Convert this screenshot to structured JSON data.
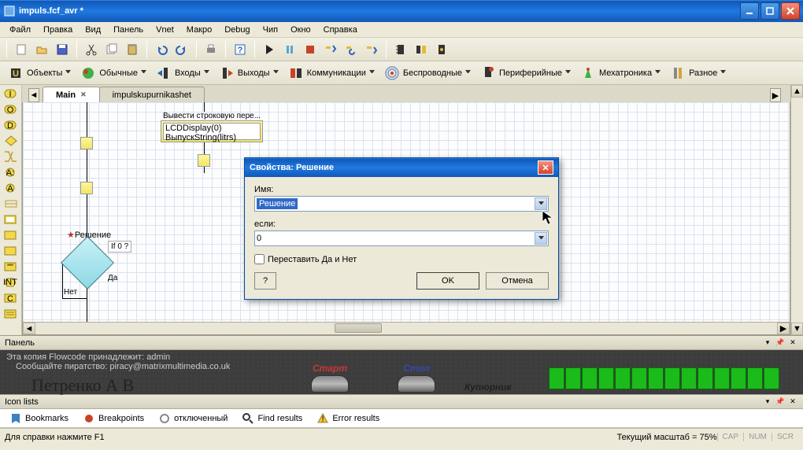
{
  "title": "impuls.fcf_avr *",
  "menu": [
    "Файл",
    "Правка",
    "Вид",
    "Панель",
    "Vnet",
    "Макро",
    "Debug",
    "Чип",
    "Окно",
    "Справка"
  ],
  "toolbar2": [
    {
      "label": "Объекты",
      "color": "#333"
    },
    {
      "label": "Обычные",
      "color": "#333"
    },
    {
      "label": "Входы",
      "color": "#333"
    },
    {
      "label": "Выходы",
      "color": "#333"
    },
    {
      "label": "Коммуникации",
      "color": "#333"
    },
    {
      "label": "Беспроводные",
      "color": "#333"
    },
    {
      "label": "Периферийные",
      "color": "#333"
    },
    {
      "label": "Мехатроника",
      "color": "#333"
    },
    {
      "label": "Разное",
      "color": "#333"
    }
  ],
  "tabs": {
    "active": "Main",
    "inactive": "impulskupurnikashet"
  },
  "flowchart": {
    "box_caption": "Вывести строковую пере...",
    "box_line1": "LCDDisplay(0)",
    "box_line2": "ВыпускString(litrs)",
    "decision_label": "Решение",
    "decision_cond": "If 0 ?",
    "yes": "Да",
    "no": "Нет"
  },
  "dialog": {
    "title": "Свойства: Решение",
    "name_label": "Имя:",
    "name_value": "Решение",
    "if_label": "если:",
    "if_value": "0",
    "swap_label": "Переставить Да и Нет",
    "ok": "OK",
    "cancel": "Отмена",
    "help": "?"
  },
  "panel": {
    "title": "Панель",
    "copy": "Эта копия Flowcode принадлежит: admin",
    "report": "Сообщайте пиратство: piracy@matrixmultimedia.co.uk",
    "signature": "Петренко А В",
    "btn1": "Старт",
    "btn1_color": "#c33838",
    "btn2": "Стоп",
    "btn2_color": "#3349b0",
    "btn3": "Купюрник",
    "btn3_color": "#222"
  },
  "iconlists": {
    "title": "Icon lists",
    "tabs": [
      "Bookmarks",
      "Breakpoints",
      "отключенный",
      "Find results",
      "Error results"
    ]
  },
  "statusbar": {
    "help": "Для справки нажмите F1",
    "zoom": "Текущий масштаб = 75%",
    "caps": "CAP",
    "num": "NUM",
    "scr": "SCR"
  }
}
